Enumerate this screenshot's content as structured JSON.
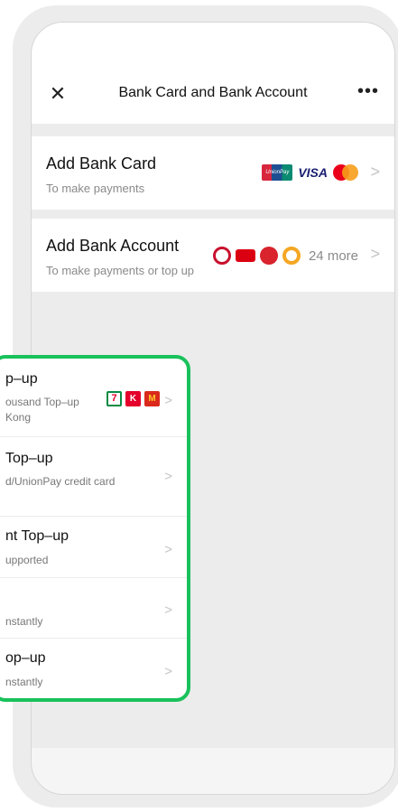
{
  "nav": {
    "close_icon": "close-icon",
    "title": "Bank Card and Bank Account",
    "more_icon": "more-icon",
    "more_glyph": "•••",
    "close_glyph": "✕"
  },
  "rows": [
    {
      "title": "Add Bank Card",
      "subtitle": "To make payments",
      "logos": [
        "unionpay-logo",
        "visa-logo",
        "mastercard-logo"
      ],
      "visa_text": "VISA",
      "unionpay_text": "UnionPay"
    },
    {
      "title": "Add Bank Account",
      "subtitle": "To make payments or top up",
      "logos": [
        "boc-logo",
        "hsbc-logo",
        "hang-seng-logo",
        "other-bank-logo"
      ],
      "more_text": "24 more"
    }
  ],
  "popup": {
    "items": [
      {
        "title": "p–up",
        "subtitle_line1": "ousand Top–up",
        "subtitle_line2": "Kong",
        "logos": [
          "7-eleven-logo",
          "circle-k-logo",
          "mcdonalds-logo"
        ]
      },
      {
        "title": "Top–up",
        "subtitle_line1": "d/UnionPay credit card",
        "subtitle_line2": ""
      },
      {
        "title": "nt Top–up",
        "subtitle_line1": "upported",
        "subtitle_line2": ""
      },
      {
        "title": "",
        "subtitle_line1": "nstantly",
        "subtitle_line2": ""
      },
      {
        "title": "op–up",
        "subtitle_line1": "nstantly",
        "subtitle_line2": ""
      }
    ],
    "border_color": "#19c15b"
  },
  "chevron": ">"
}
